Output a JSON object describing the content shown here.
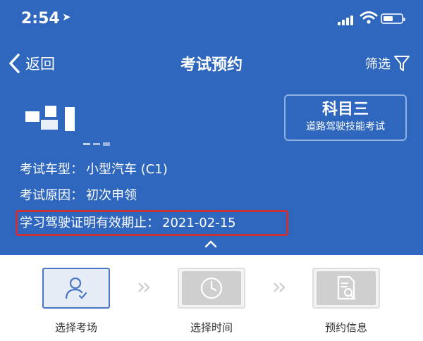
{
  "status_bar": {
    "time": "2:54",
    "location_glyph": "➤"
  },
  "nav": {
    "back_label": "返回",
    "title": "考试预约",
    "filter_label": "筛选"
  },
  "subject_card": {
    "title": "科目三",
    "subtitle": "道路驾驶技能考试"
  },
  "info": {
    "vehicle_type_label": "考试车型：",
    "vehicle_type_value": "小型汽车 (C1)",
    "reason_label": "考试原因：",
    "reason_value": "初次申领",
    "permit_label": "学习驾驶证明有效期止：",
    "permit_value": "2021-02-15"
  },
  "steps": [
    {
      "label": "选择考场",
      "icon": "user-check-icon",
      "state": "active"
    },
    {
      "label": "选择时间",
      "icon": "clock-icon",
      "state": "inactive"
    },
    {
      "label": "预约信息",
      "icon": "document-search-icon",
      "state": "inactive"
    }
  ],
  "colors": {
    "header_blue": "#2e67bd",
    "highlight_red": "#c8313a",
    "active_step_border": "#4876c4"
  }
}
